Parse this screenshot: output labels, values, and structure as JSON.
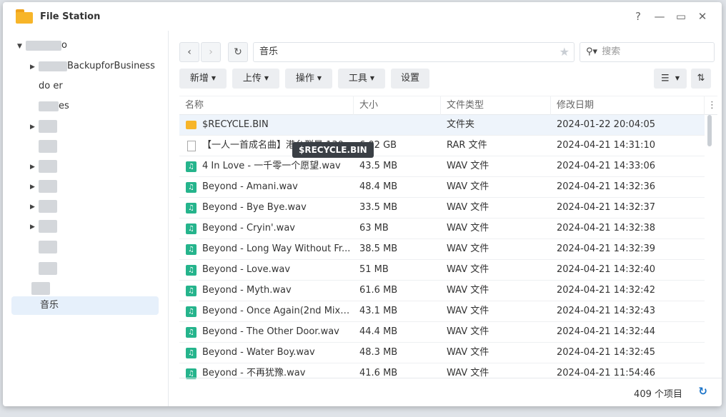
{
  "window": {
    "title": "File Station",
    "help": "?",
    "minimize": "—",
    "maximize": "▭",
    "close": "✕"
  },
  "sidebar": {
    "items": [
      {
        "label": "o",
        "arrow": "▼"
      },
      {
        "label": "BackupforBusiness",
        "arrow": "▶"
      },
      {
        "label": "do er",
        "arrow": ""
      },
      {
        "label": "es",
        "arrow": ""
      },
      {
        "label": "",
        "arrow": "▶"
      },
      {
        "label": "",
        "arrow": "▶"
      },
      {
        "label": "",
        "arrow": "▶"
      },
      {
        "label": "",
        "arrow": "▶"
      },
      {
        "label": "",
        "arrow": "▶"
      },
      {
        "label": "",
        "arrow": "▶"
      },
      {
        "label": "",
        "arrow": ""
      },
      {
        "label": "",
        "arrow": ""
      },
      {
        "label": "音乐",
        "arrow": ""
      }
    ]
  },
  "nav": {
    "back": "‹",
    "forward": "›",
    "refresh": "↻",
    "path": "音乐",
    "star": "★"
  },
  "search": {
    "placeholder": "搜索",
    "icon": "search-icon"
  },
  "toolbar": {
    "create": "新增",
    "upload": "上传",
    "action": "操作",
    "tools": "工具",
    "settings": "设置"
  },
  "columns": {
    "name": "名称",
    "size": "大小",
    "type": "文件类型",
    "date": "修改日期"
  },
  "files": [
    {
      "name": "$RECYCLE.BIN",
      "size": "",
      "type": "文件夹",
      "date": "2024-01-22 20:04:05",
      "icon": "folder"
    },
    {
      "name": "【一人一首成名曲】港台群星 130",
      "size": "6.02 GB",
      "type": "RAR 文件",
      "date": "2024-04-21 14:31:10",
      "icon": "rar"
    },
    {
      "name": "4 In Love - 一千零一个愿望.wav",
      "size": "43.5 MB",
      "type": "WAV 文件",
      "date": "2024-04-21 14:33:06",
      "icon": "audio"
    },
    {
      "name": "Beyond - Amani.wav",
      "size": "48.4 MB",
      "type": "WAV 文件",
      "date": "2024-04-21 14:32:36",
      "icon": "audio"
    },
    {
      "name": "Beyond - Bye Bye.wav",
      "size": "33.5 MB",
      "type": "WAV 文件",
      "date": "2024-04-21 14:32:37",
      "icon": "audio"
    },
    {
      "name": "Beyond - Cryin'.wav",
      "size": "63 MB",
      "type": "WAV 文件",
      "date": "2024-04-21 14:32:38",
      "icon": "audio"
    },
    {
      "name": "Beyond - Long Way Without Fr...",
      "size": "38.5 MB",
      "type": "WAV 文件",
      "date": "2024-04-21 14:32:39",
      "icon": "audio"
    },
    {
      "name": "Beyond - Love.wav",
      "size": "51 MB",
      "type": "WAV 文件",
      "date": "2024-04-21 14:32:40",
      "icon": "audio"
    },
    {
      "name": "Beyond - Myth.wav",
      "size": "61.6 MB",
      "type": "WAV 文件",
      "date": "2024-04-21 14:32:42",
      "icon": "audio"
    },
    {
      "name": "Beyond - Once Again(2nd Mix)...",
      "size": "43.1 MB",
      "type": "WAV 文件",
      "date": "2024-04-21 14:32:43",
      "icon": "audio"
    },
    {
      "name": "Beyond - The Other Door.wav",
      "size": "44.4 MB",
      "type": "WAV 文件",
      "date": "2024-04-21 14:32:44",
      "icon": "audio"
    },
    {
      "name": "Beyond - Water Boy.wav",
      "size": "48.3 MB",
      "type": "WAV 文件",
      "date": "2024-04-21 14:32:45",
      "icon": "audio"
    },
    {
      "name": "Beyond - 不再犹豫.wav",
      "size": "41.6 MB",
      "type": "WAV 文件",
      "date": "2024-04-21 11:54:46",
      "icon": "audio"
    }
  ],
  "tooltip": "$RECYCLE.BIN",
  "footer": {
    "count": "409 个项目",
    "refresh": "↻"
  },
  "colors": {
    "accent": "#1a73c8",
    "audio_icon": "#25b48c",
    "folder_icon": "#f7b529"
  }
}
